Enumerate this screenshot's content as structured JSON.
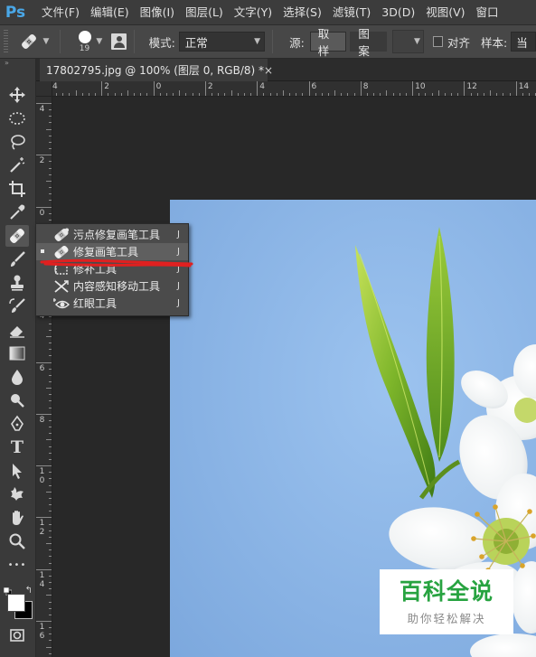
{
  "app": {
    "logo": "Ps"
  },
  "menubar": {
    "items": [
      "文件(F)",
      "编辑(E)",
      "图像(I)",
      "图层(L)",
      "文字(Y)",
      "选择(S)",
      "滤镜(T)",
      "3D(D)",
      "视图(V)",
      "窗口"
    ]
  },
  "options_bar": {
    "tool_preset_icon": "healing-brush-icon",
    "brush_size": "19",
    "mode_label": "模式:",
    "mode_value": "正常",
    "source_label": "源:",
    "source_sampled": "取样",
    "source_pattern": "图案",
    "align_label": "对齐",
    "align_checked": false,
    "sample_label": "样本:",
    "sample_value": "当"
  },
  "document": {
    "tab_title": "17802795.jpg @ 100% (图层 0, RGB/8) *",
    "close_glyph": "×",
    "zoom": "100%"
  },
  "rulers": {
    "horizontal": [
      "4",
      "2",
      "0",
      "2",
      "4",
      "6",
      "8",
      "10",
      "12",
      "14"
    ],
    "vertical": [
      "4",
      "2",
      "0",
      "2",
      "4",
      "6",
      "8",
      "10",
      "12",
      "14",
      "16"
    ]
  },
  "toolbar": {
    "collapse_glyph": "»",
    "tools": [
      {
        "name": "move-tool",
        "icon": "move-icon"
      },
      {
        "name": "marquee-tool",
        "icon": "marquee-icon"
      },
      {
        "name": "lasso-tool",
        "icon": "lasso-icon"
      },
      {
        "name": "magic-wand-tool",
        "icon": "magic-wand-icon"
      },
      {
        "name": "crop-tool",
        "icon": "crop-icon"
      },
      {
        "name": "eyedropper-tool",
        "icon": "eyedropper-icon"
      },
      {
        "name": "healing-brush-tool",
        "icon": "healing-brush-icon",
        "active": true
      },
      {
        "name": "brush-tool",
        "icon": "brush-icon"
      },
      {
        "name": "clone-stamp-tool",
        "icon": "stamp-icon"
      },
      {
        "name": "history-brush-tool",
        "icon": "history-brush-icon"
      },
      {
        "name": "eraser-tool",
        "icon": "eraser-icon"
      },
      {
        "name": "gradient-tool",
        "icon": "gradient-icon"
      },
      {
        "name": "blur-tool",
        "icon": "blur-icon"
      },
      {
        "name": "dodge-tool",
        "icon": "dodge-icon"
      },
      {
        "name": "pen-tool",
        "icon": "pen-icon"
      },
      {
        "name": "type-tool",
        "icon": "type-icon"
      },
      {
        "name": "path-selection-tool",
        "icon": "path-selection-icon"
      },
      {
        "name": "custom-shape-tool",
        "icon": "custom-shape-icon"
      },
      {
        "name": "hand-tool",
        "icon": "hand-icon"
      },
      {
        "name": "zoom-tool",
        "icon": "zoom-icon"
      },
      {
        "name": "more-tools",
        "icon": "more-icon"
      },
      {
        "name": "quick-mask",
        "icon": "quick-mask-icon"
      }
    ],
    "foreground_color": "#ffffff",
    "background_color": "#000000",
    "swap_glyph": "↰",
    "more_glyph": "•••",
    "type_glyph": "T"
  },
  "flyout": {
    "items": [
      {
        "label": "污点修复画笔工具",
        "shortcut": "J",
        "icon": "spot-healing-icon",
        "selected": false
      },
      {
        "label": "修复画笔工具",
        "shortcut": "J",
        "icon": "healing-brush-icon",
        "selected": true
      },
      {
        "label": "修补工具",
        "shortcut": "J",
        "icon": "patch-icon",
        "selected": false
      },
      {
        "label": "内容感知移动工具",
        "shortcut": "J",
        "icon": "content-aware-move-icon",
        "selected": false
      },
      {
        "label": "红眼工具",
        "shortcut": "J",
        "icon": "red-eye-icon",
        "selected": false
      }
    ]
  },
  "watermark": {
    "title": "百科全说",
    "subtitle": "助你轻松解决",
    "title_color": "#27a340"
  },
  "annotation": {
    "underline_color": "#e02020"
  }
}
